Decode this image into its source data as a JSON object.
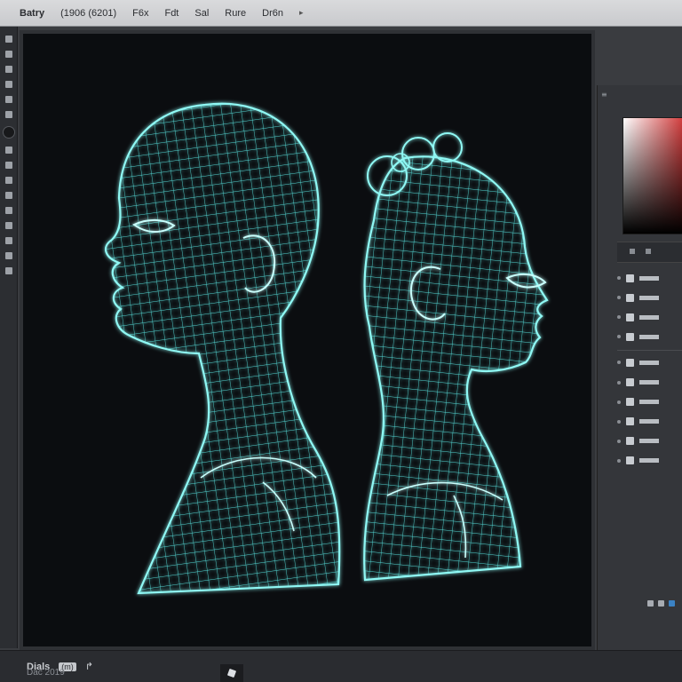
{
  "menubar": {
    "title": "Batry",
    "info": "(1906  (6201)",
    "items": [
      "F6x",
      "Fdt",
      "Sal",
      "Rure",
      "Dr6n"
    ],
    "chevron": "▸"
  },
  "statusbar": {
    "zoom": "Dials",
    "doc_info": "(m)",
    "arrow": "↱",
    "footer_label": "Dac 2019"
  },
  "canvas": {
    "background": "#0b0d10",
    "wire_color": "#5ef2ee",
    "figures": [
      "head-left-facing",
      "head-right-facing-with-bun"
    ]
  },
  "right_panel": {
    "header": "≡",
    "layers_count": 10
  },
  "colors": {
    "menubar": "#cfd0d3",
    "panel": "#34363a",
    "accent_blue": "#3b82c4"
  }
}
